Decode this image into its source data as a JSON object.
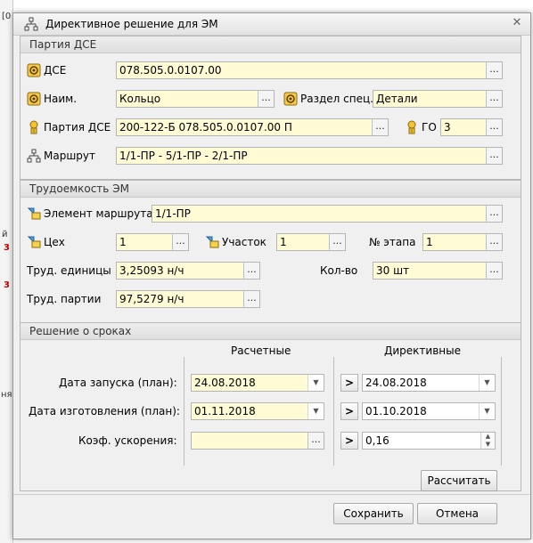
{
  "background": {
    "top_text": "[0",
    "fragments": [
      "й",
      "3",
      "3",
      "ня"
    ]
  },
  "window": {
    "title": "Директивное решение для ЭМ"
  },
  "party": {
    "header": "Партия ДСЕ",
    "dse_label": "ДСЕ",
    "dse_value": "078.505.0.0107.00",
    "name_label": "Наим.",
    "name_value": "Кольцо",
    "section_label": "Раздел спец.",
    "section_value": "Детали",
    "batch_label": "Партия ДСЕ",
    "batch_value": "200-122-Б 078.505.0.0107.00 П",
    "go_label": "ГО",
    "go_value": "3",
    "route_label": "Маршрут",
    "route_value": "1/1-ПР - 5/1-ПР - 2/1-ПР"
  },
  "labor": {
    "header": "Трудоемкость ЭМ",
    "element_label": "Элемент маршрута",
    "element_value": "1/1-ПР",
    "shop_label": "Цех",
    "shop_value": "1",
    "area_label": "Участок",
    "area_value": "1",
    "stage_label": "№ этапа",
    "stage_value": "1",
    "unit_label": "Труд. единицы",
    "unit_value": "3,25093 н/ч",
    "qty_label": "Кол-во",
    "qty_value": "30 шт",
    "batch_labor_label": "Труд. партии",
    "batch_labor_value": "97,5279 н/ч"
  },
  "terms": {
    "header": "Решение о сроках",
    "calc_header": "Расчетные",
    "dir_header": "Директивные",
    "launch_label": "Дата запуска (план):",
    "launch_calc": "24.08.2018",
    "launch_dir": "24.08.2018",
    "make_label": "Дата изготовления (план):",
    "make_calc": "01.11.2018",
    "make_dir": "01.10.2018",
    "accel_label": "Коэф. ускорения:",
    "accel_calc": "",
    "accel_dir": "0,16",
    "calculate_button": "Рассчитать"
  },
  "footer": {
    "save_button": "Сохранить",
    "cancel_button": "Отмена"
  },
  "icons": {
    "ellipsis": "...",
    "arrow": ">",
    "dropdown": "▼",
    "close": "✕"
  }
}
